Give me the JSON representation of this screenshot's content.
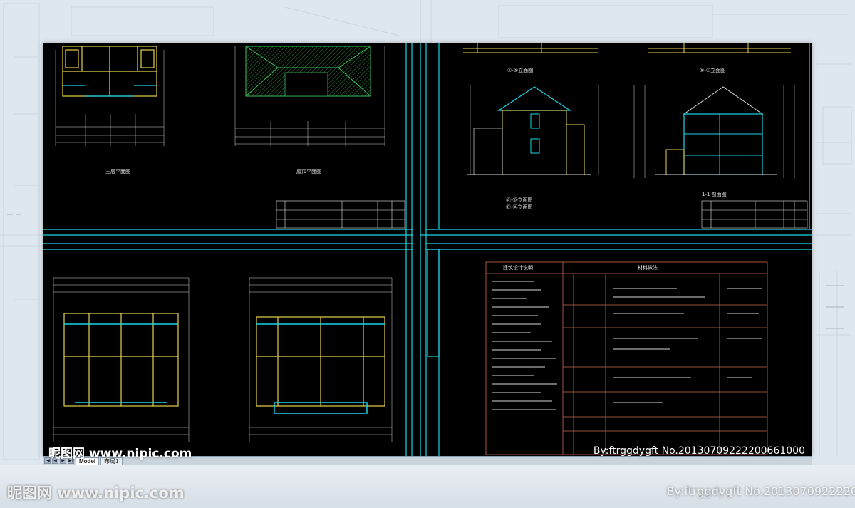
{
  "watermark": {
    "site_brand": "昵图网 www.nipic.com",
    "author_id": "By:ftrggdygft  No.20130709222200661000",
    "site_brand_ghost": "昵图网 www.nipic.com",
    "author_id_ghost": "By:ftrggdygft  No.2013070922220"
  },
  "cad": {
    "tabs": [
      "Model",
      "布局1"
    ],
    "nav_buttons": [
      "|◀",
      "◀",
      "▶",
      "▶|"
    ],
    "drawing_labels": {
      "third_floor_plan": "三层平面图",
      "roof_plan": "屋顶平面图",
      "elevation_a": "①-⑤立面图",
      "elevation_b": "⑤-①立面图",
      "section_1_1": "1-1 剖面图",
      "elevation_side": "Ⓐ-Ⓓ立面图",
      "elevation_side_b": "Ⓓ-Ⓐ立面图"
    },
    "notes_table": {
      "title_left": "建筑设计说明",
      "title_right": "材料做法"
    }
  },
  "colors": {
    "background": "#dfe7ee",
    "cad_background": "#000000",
    "frame_cyan": "#19d6e6",
    "wall_yellow": "#e6d24a",
    "dim_white": "#d8d8d8",
    "table_red": "#c86a4a",
    "roof_green": "#3fbf5a"
  }
}
